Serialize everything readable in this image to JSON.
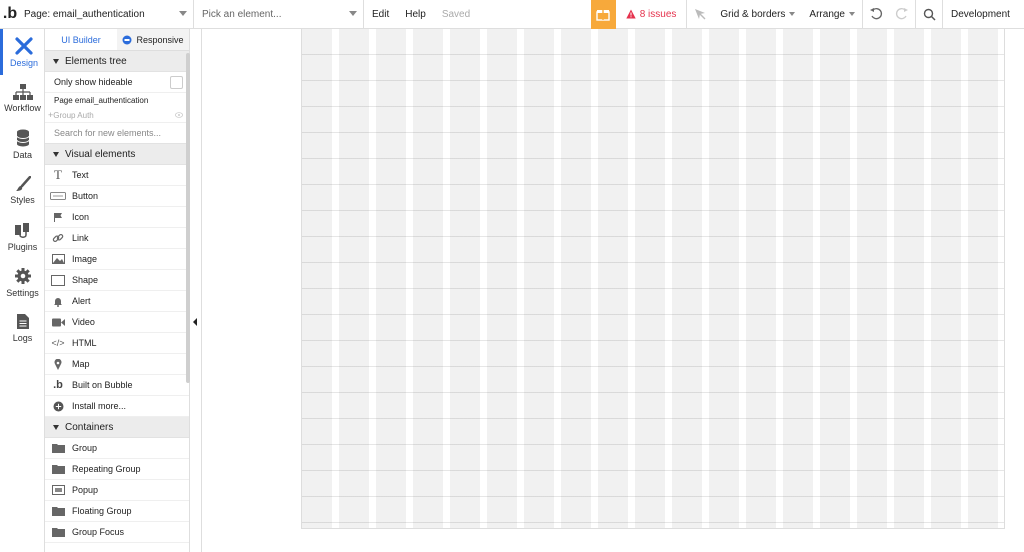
{
  "topbar": {
    "logo": ".b",
    "page_label": "Page: email_authentication",
    "element_placeholder": "Pick an element...",
    "edit": "Edit",
    "help": "Help",
    "saved": "Saved",
    "issues": "8 issues",
    "grid_borders": "Grid & borders",
    "arrange": "Arrange",
    "environment": "Development"
  },
  "leftnav": {
    "items": [
      {
        "label": "Design",
        "icon": "design-icon"
      },
      {
        "label": "Workflow",
        "icon": "workflow-icon"
      },
      {
        "label": "Data",
        "icon": "database-icon"
      },
      {
        "label": "Styles",
        "icon": "brush-icon"
      },
      {
        "label": "Plugins",
        "icon": "plug-icon"
      },
      {
        "label": "Settings",
        "icon": "gear-icon"
      },
      {
        "label": "Logs",
        "icon": "document-icon"
      }
    ]
  },
  "panel": {
    "tabs": {
      "ui_builder": "UI Builder",
      "responsive": "Responsive"
    },
    "elements_tree": "Elements tree",
    "only_show_hideable": "Only show hideable",
    "tree_page": "Page email_authentication",
    "tree_group": "Group Auth",
    "search_placeholder": "Search for new elements...",
    "visual_elements": "Visual elements",
    "visual": [
      "Text",
      "Button",
      "Icon",
      "Link",
      "Image",
      "Shape",
      "Alert",
      "Video",
      "HTML",
      "Map",
      "Built on Bubble",
      "Install more..."
    ],
    "containers": "Containers",
    "container_items": [
      "Group",
      "Repeating Group",
      "Popup",
      "Floating Group",
      "Group Focus"
    ]
  },
  "colors": {
    "accent": "#2b6cdb",
    "issues": "#e5324d",
    "gift": "#f7a93b"
  }
}
